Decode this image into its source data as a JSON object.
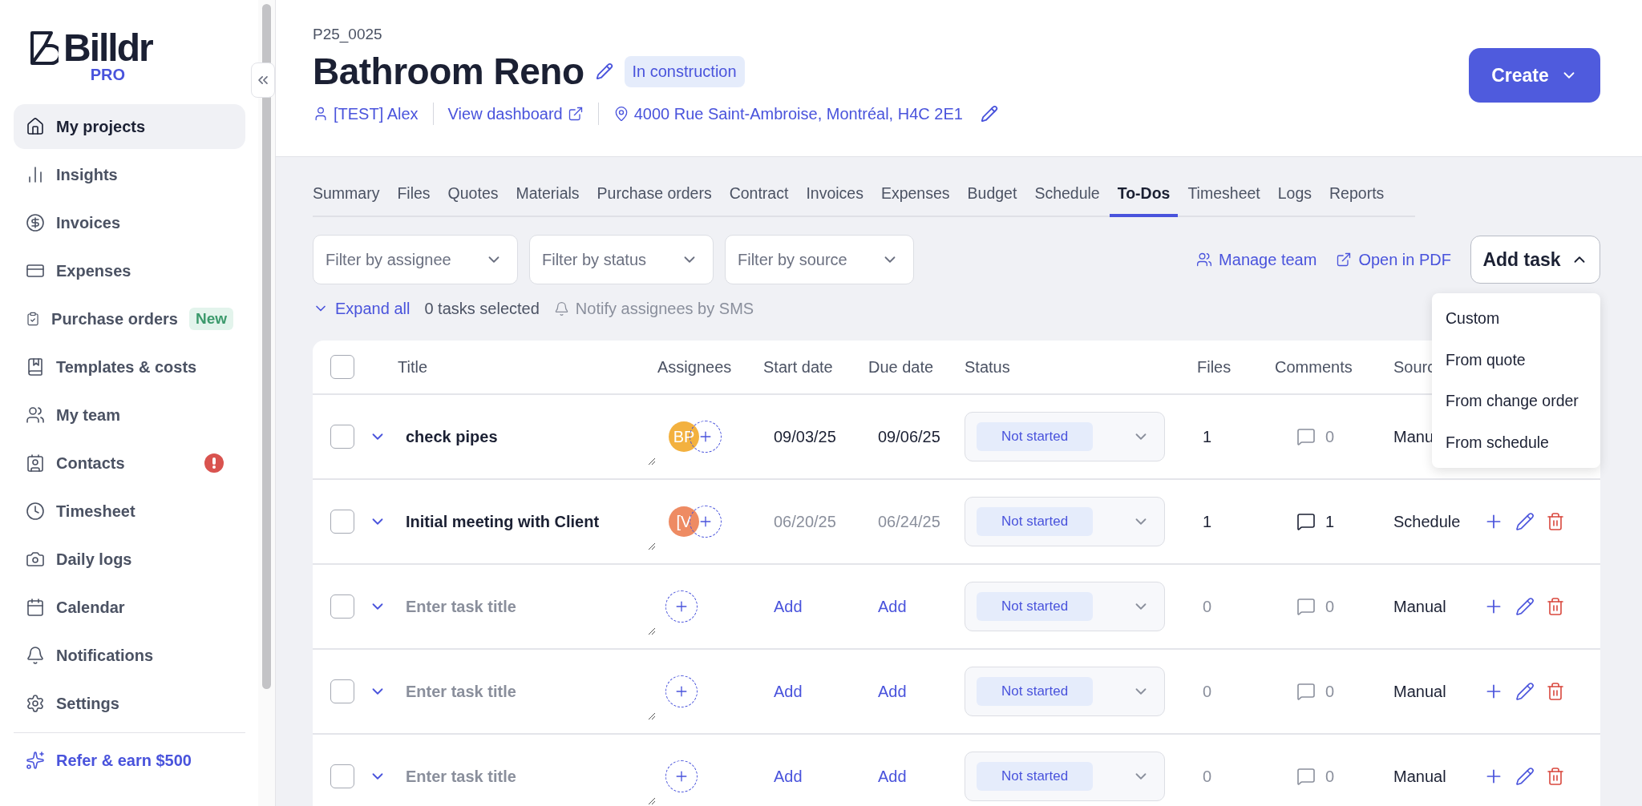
{
  "sidebar": {
    "logo": "Billdr",
    "plan": "PRO",
    "items": [
      {
        "label": "My projects",
        "selected": true
      },
      {
        "label": "Insights",
        "selected": false
      },
      {
        "label": "Invoices",
        "selected": false
      },
      {
        "label": "Expenses",
        "selected": false
      },
      {
        "label": "Purchase orders",
        "selected": false,
        "badge": "New"
      },
      {
        "label": "Templates & costs",
        "selected": false
      },
      {
        "label": "My team",
        "selected": false
      },
      {
        "label": "Contacts",
        "selected": false,
        "alert": true
      },
      {
        "label": "Timesheet",
        "selected": false
      },
      {
        "label": "Daily logs",
        "selected": false
      },
      {
        "label": "Calendar",
        "selected": false
      },
      {
        "label": "Notifications",
        "selected": false
      },
      {
        "label": "Settings",
        "selected": false
      }
    ],
    "referral": "Refer & earn $500"
  },
  "project": {
    "code": "P25_0025",
    "title": "Bathroom Reno",
    "status": "In construction",
    "client": "[TEST] Alex",
    "dashboard_link": "View dashboard",
    "address": "4000 Rue Saint-Ambroise, Montréal, H4C 2E1",
    "create_button": "Create"
  },
  "tabs": [
    {
      "label": "Summary",
      "selected": false
    },
    {
      "label": "Files",
      "selected": false
    },
    {
      "label": "Quotes",
      "selected": false
    },
    {
      "label": "Materials",
      "selected": false
    },
    {
      "label": "Purchase orders",
      "selected": false
    },
    {
      "label": "Contract",
      "selected": false
    },
    {
      "label": "Invoices",
      "selected": false
    },
    {
      "label": "Expenses",
      "selected": false
    },
    {
      "label": "Budget",
      "selected": false
    },
    {
      "label": "Schedule",
      "selected": false
    },
    {
      "label": "To-Dos",
      "selected": true
    },
    {
      "label": "Timesheet",
      "selected": false
    },
    {
      "label": "Logs",
      "selected": false
    },
    {
      "label": "Reports",
      "selected": false
    }
  ],
  "filters": [
    {
      "placeholder": "Filter by assignee"
    },
    {
      "placeholder": "Filter by status"
    },
    {
      "placeholder": "Filter by source"
    }
  ],
  "toolbar": {
    "manage_team": "Manage team",
    "open_pdf": "Open in PDF",
    "add_task": "Add task",
    "add_task_expanded": true,
    "add_task_menu": [
      "Custom",
      "From quote",
      "From change order",
      "From schedule"
    ],
    "expand_all": "Expand all",
    "selected_count": "0 tasks selected",
    "notify": "Notify assignees by SMS"
  },
  "table": {
    "all_checked": false,
    "columns": [
      "Title",
      "Assignees",
      "Start date",
      "Due date",
      "Status",
      "Files",
      "Comments",
      "Sourc"
    ],
    "rows": [
      {
        "checked": false,
        "title": "check pipes",
        "assignee": {
          "initials": "BP",
          "color": "#f3b13f"
        },
        "start": "09/03/25",
        "due": "09/06/25",
        "dates_muted": false,
        "status": "Not started",
        "files": "1",
        "files_active": true,
        "comments": "0",
        "comments_active": false,
        "source": "Manu"
      },
      {
        "checked": false,
        "title": "Initial meeting with Client",
        "assignee": {
          "initials": "[V",
          "color": "#ee8b63"
        },
        "start": "06/20/25",
        "due": "06/24/25",
        "dates_muted": true,
        "status": "Not started",
        "files": "1",
        "files_active": true,
        "comments": "1",
        "comments_active": true,
        "source": "Schedule"
      },
      {
        "checked": false,
        "placeholder": "Enter task title",
        "start": "Add",
        "due": "Add",
        "status": "Not started",
        "files": "0",
        "files_active": false,
        "comments": "0",
        "comments_active": false,
        "source": "Manual"
      },
      {
        "checked": false,
        "placeholder": "Enter task title",
        "start": "Add",
        "due": "Add",
        "status": "Not started",
        "files": "0",
        "files_active": false,
        "comments": "0",
        "comments_active": false,
        "source": "Manual"
      },
      {
        "checked": false,
        "placeholder": "Enter task title",
        "start": "Add",
        "due": "Add",
        "status": "Not started",
        "files": "0",
        "files_active": false,
        "comments": "0",
        "comments_active": false,
        "source": "Manual"
      }
    ]
  }
}
